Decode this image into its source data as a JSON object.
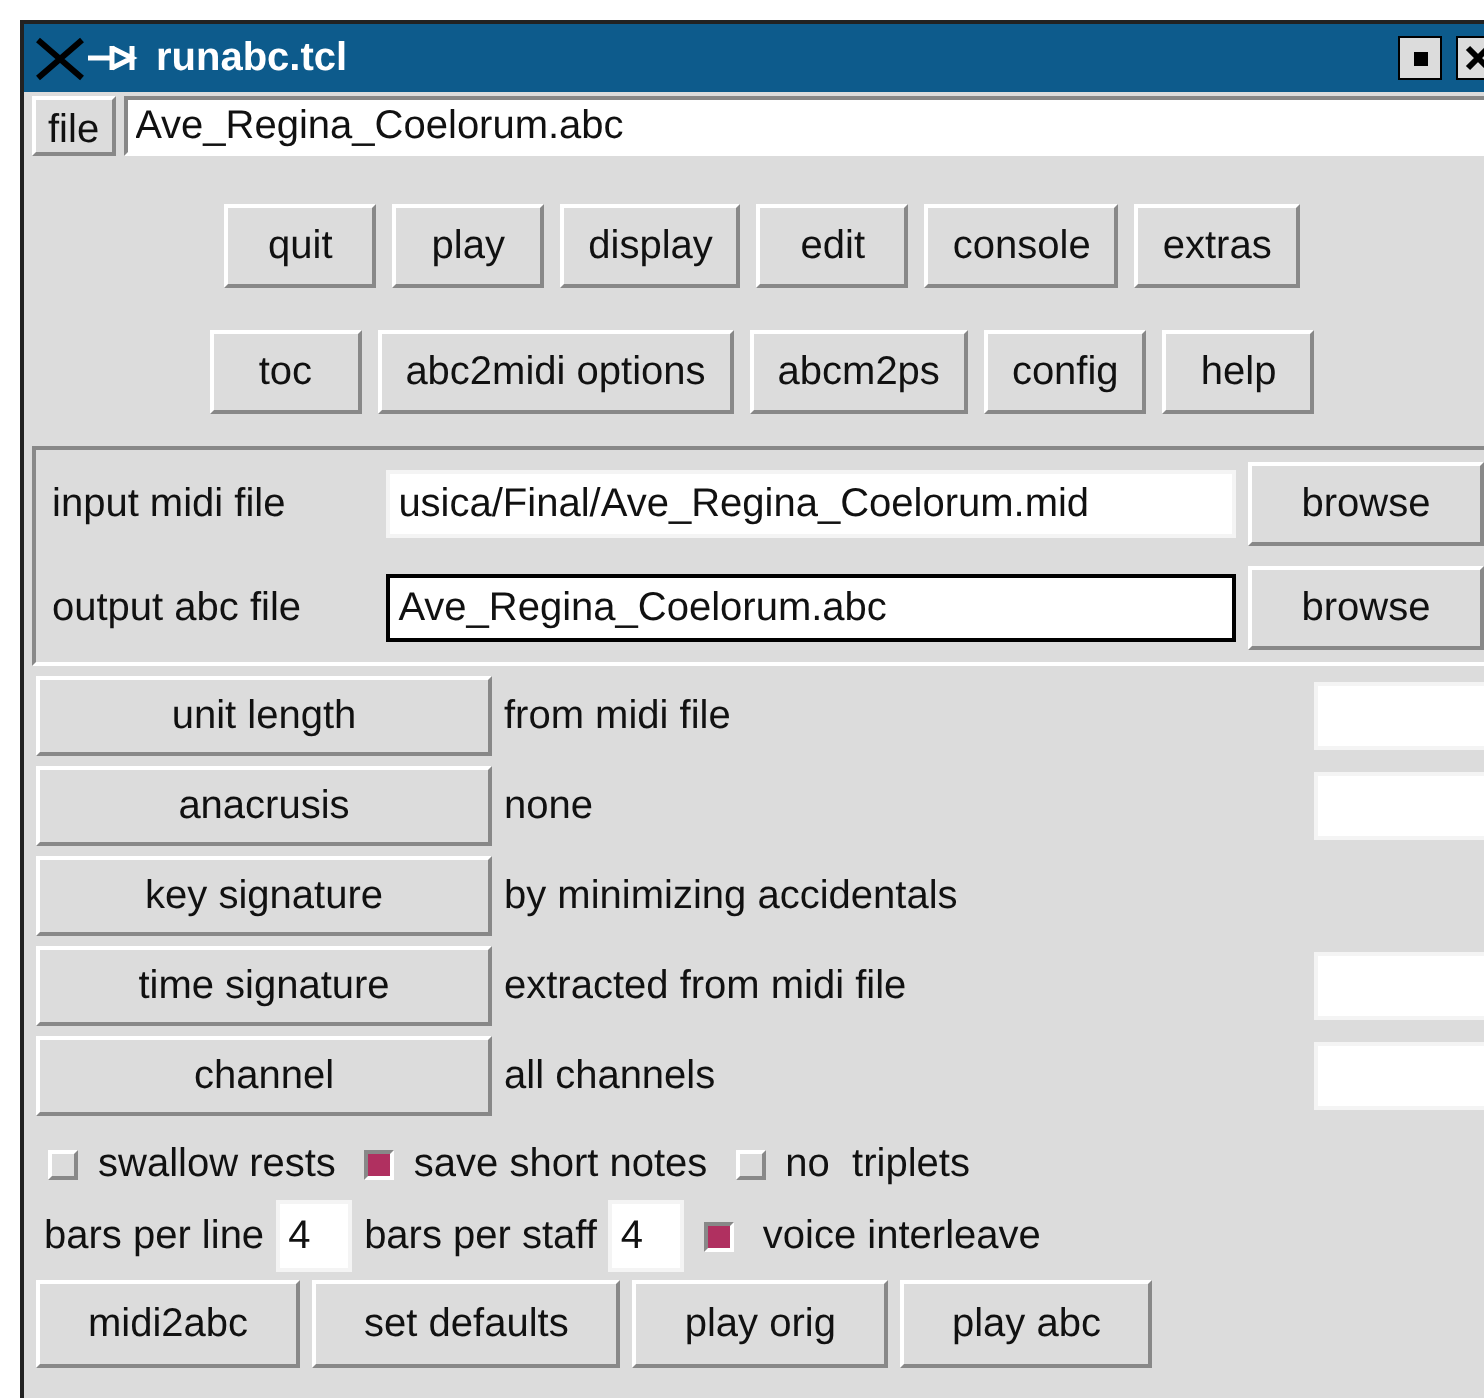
{
  "window": {
    "title": "runabc.tcl"
  },
  "file_bar": {
    "button": "file",
    "value": "Ave_Regina_Coelorum.abc"
  },
  "toolbar_rows": [
    [
      "quit",
      "play",
      "display",
      "edit",
      "console",
      "extras"
    ],
    [
      "toc",
      "abc2midi options",
      "abcm2ps",
      "config",
      "help"
    ]
  ],
  "files": [
    {
      "label": "input midi file",
      "value": "usica/Final/Ave_Regina_Coelorum.mid",
      "focused": false,
      "button": "browse"
    },
    {
      "label": "output abc file",
      "value": "Ave_Regina_Coelorum.abc",
      "focused": true,
      "button": "browse"
    }
  ],
  "options": [
    {
      "button": "unit length",
      "value": "from midi file",
      "entry": true
    },
    {
      "button": "anacrusis",
      "value": "none",
      "entry": true
    },
    {
      "button": "key signature",
      "value": "by minimizing accidentals",
      "entry": false
    },
    {
      "button": "time signature",
      "value": "extracted from midi file",
      "entry": true
    },
    {
      "button": "channel",
      "value": "all channels",
      "entry": true
    }
  ],
  "checkboxes": [
    {
      "label": "swallow rests",
      "checked": false
    },
    {
      "label": "save short notes",
      "checked": true
    },
    {
      "label": "no  triplets",
      "checked": false
    }
  ],
  "bars": {
    "per_line_label": "bars per line",
    "per_line": "4",
    "per_staff_label": "bars per staff",
    "per_staff": "4",
    "interleave": {
      "label": "voice interleave",
      "checked": true
    }
  },
  "actions": [
    "midi2abc",
    "set defaults",
    "play orig",
    "play abc"
  ]
}
